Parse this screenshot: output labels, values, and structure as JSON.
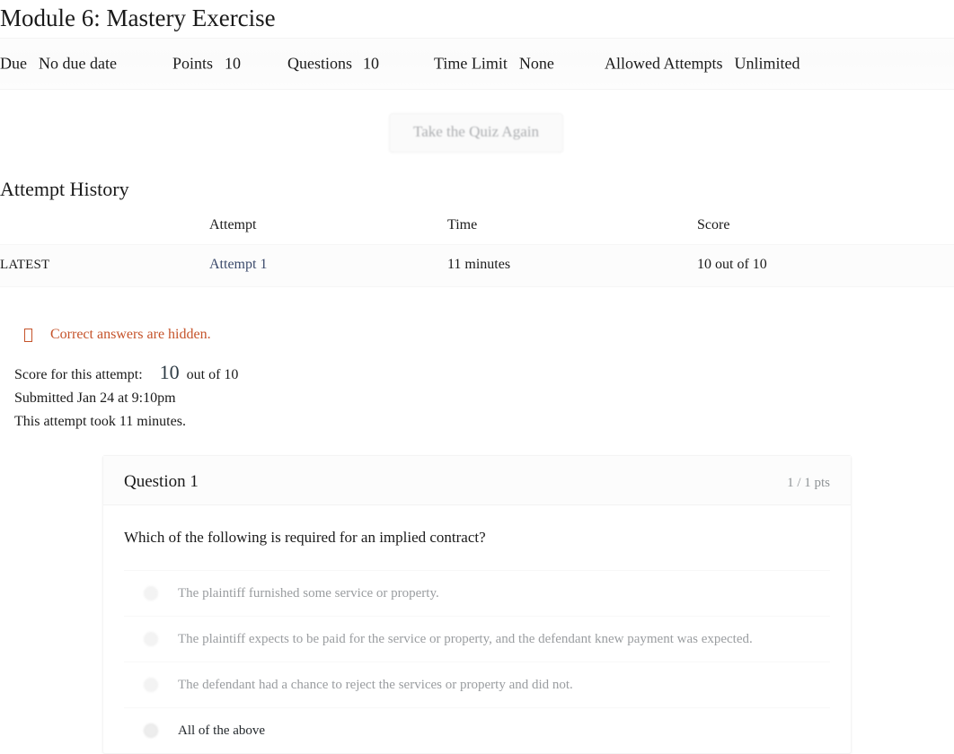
{
  "quiz": {
    "title": "Module 6: Mastery Exercise",
    "meta": [
      {
        "label": "Due",
        "value": "No due date"
      },
      {
        "label": "Points",
        "value": "10"
      },
      {
        "label": "Questions",
        "value": "10"
      },
      {
        "label": "Time Limit",
        "value": "None"
      },
      {
        "label": "Allowed Attempts",
        "value": "Unlimited"
      }
    ],
    "retake_label": "Take the Quiz Again"
  },
  "attempt_history": {
    "heading": "Attempt History",
    "columns": {
      "latest": "",
      "attempt": "Attempt",
      "time": "Time",
      "score": "Score"
    },
    "rows": [
      {
        "latest_flag": "LATEST",
        "attempt": "Attempt 1",
        "time": "11 minutes",
        "score": "10 out of 10"
      }
    ]
  },
  "notice": {
    "icon": "hidden-eye-icon",
    "text": "Correct answers are hidden.",
    "color": "#c5532a"
  },
  "attempt_summary": {
    "score_label": "Score for this attempt:",
    "score_value": "10",
    "score_outof": "out of 10",
    "submitted": "Submitted Jan 24 at 9:10pm",
    "duration": "This attempt took 11 minutes."
  },
  "question": {
    "name": "Question 1",
    "points": "1 / 1 pts",
    "text": "Which of the following is required for an implied contract?",
    "answers": [
      {
        "text": "The plaintiff furnished some service or property.",
        "selected": false
      },
      {
        "text": "The plaintiff expects to be paid for the service or property, and the defendant knew payment was expected.",
        "selected": false
      },
      {
        "text": "The defendant had a chance to reject the services or property and did not.",
        "selected": false
      },
      {
        "text": "All of the above",
        "selected": true
      }
    ]
  }
}
